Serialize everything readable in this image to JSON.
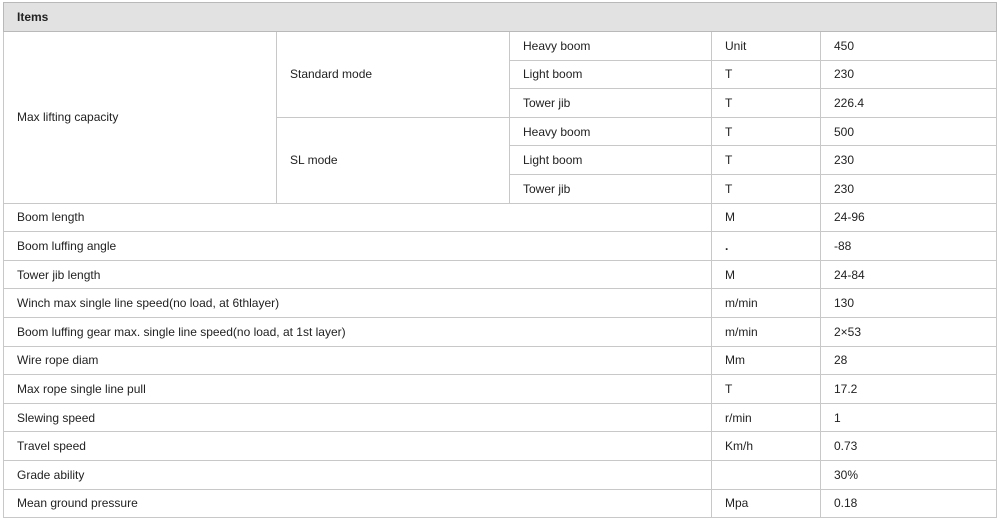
{
  "header": {
    "title": "Items"
  },
  "max_lifting": {
    "label": "Max lifting capacity",
    "standard_mode": {
      "label": "Standard mode",
      "rows": [
        {
          "item": "Heavy boom",
          "unit": "Unit",
          "value": "450"
        },
        {
          "item": "Light boom",
          "unit": "T",
          "value": "230"
        },
        {
          "item": "Tower jib",
          "unit": "T",
          "value": "226.4"
        }
      ]
    },
    "sl_mode": {
      "label": "SL mode",
      "rows": [
        {
          "item": "Heavy boom",
          "unit": "T",
          "value": "500"
        },
        {
          "item": "Light boom",
          "unit": "T",
          "value": "230"
        },
        {
          "item": "Tower jib",
          "unit": "T",
          "value": "230"
        }
      ]
    }
  },
  "rows": [
    {
      "item": "Boom length",
      "unit": "M",
      "value": "24-96"
    },
    {
      "item": "Boom luffing angle",
      "unit": ".",
      "value": "-88"
    },
    {
      "item": "Tower jib length",
      "unit": "M",
      "value": "24-84"
    },
    {
      "item": "Winch max single line speed(no load, at 6thlayer)",
      "unit": "m/min",
      "value": "130"
    },
    {
      "item": "Boom luffing gear max. single line speed(no load, at 1st layer)",
      "unit": "m/min",
      "value": "2×53"
    },
    {
      "item": "Wire rope diam",
      "unit": "Mm",
      "value": "28"
    },
    {
      "item": "Max rope single line pull",
      "unit": "T",
      "value": "17.2"
    },
    {
      "item": "Slewing speed",
      "unit": "r/min",
      "value": "1"
    },
    {
      "item": "Travel speed",
      "unit": "Km/h",
      "value": "0.73"
    },
    {
      "item": "Grade ability",
      "unit": "",
      "value": "30%"
    },
    {
      "item": "Mean ground pressure",
      "unit": "Mpa",
      "value": "0.18"
    }
  ]
}
